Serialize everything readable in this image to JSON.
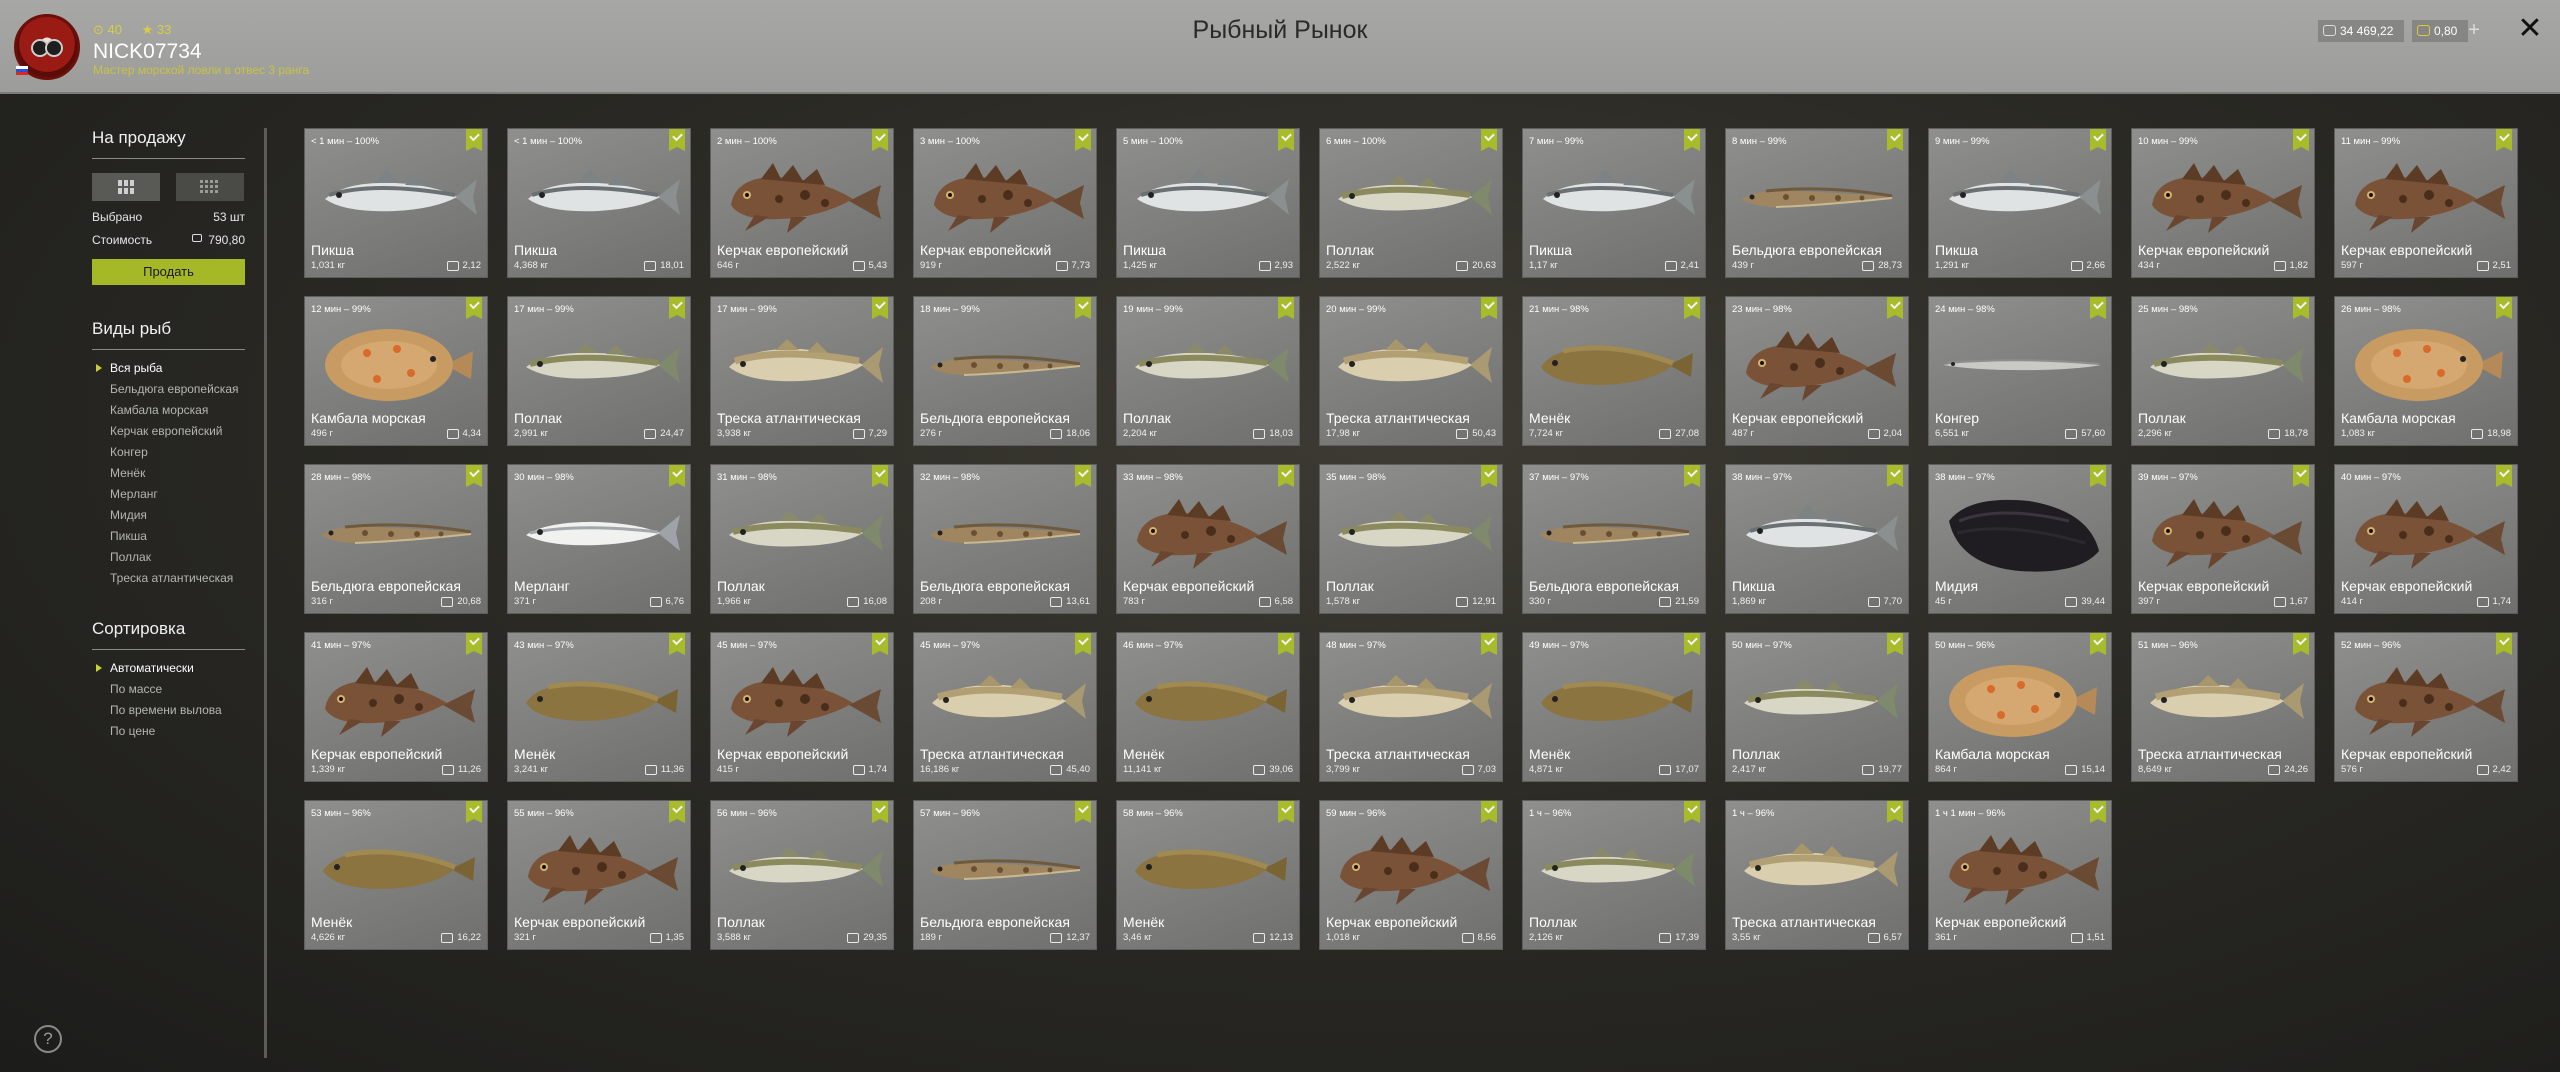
{
  "header": {
    "title": "Рыбный Рынок",
    "user": {
      "name": "NICK07734",
      "rank_text": "Мастер морской ловли в отвес 3 ранга",
      "stat1": "40",
      "stat2": "33"
    },
    "balance_silver": "34 469,22",
    "balance_gold": "0,80",
    "plus": "+",
    "close": "✕"
  },
  "sidebar": {
    "sale_title": "На продажу",
    "selected_label": "Выбрано",
    "selected_value": "53 шт",
    "cost_label": "Стоимость",
    "cost_value": "790,80",
    "sell_button": "Продать",
    "species_title": "Виды рыб",
    "species": [
      "Вся рыба",
      "Бельдюга европейская",
      "Камбала морская",
      "Керчак европейский",
      "Конгер",
      "Менёк",
      "Мерланг",
      "Мидия",
      "Пикша",
      "Поллак",
      "Треска атлантическая"
    ],
    "sort_title": "Сортировка",
    "sort_options": [
      "Автоматически",
      "По массе",
      "По времени вылова",
      "По цене"
    ],
    "help": "?"
  },
  "colors": {
    "accent": "#a8bb2a",
    "header_bg": "#a7a8a5",
    "card_bg": "#858583"
  },
  "cards": [
    {
      "meta": "< 1 мин – 100%",
      "name": "Пикша",
      "weight": "1,031 кг",
      "price": "2,12",
      "type": "haddock"
    },
    {
      "meta": "< 1 мин – 100%",
      "name": "Пикша",
      "weight": "4,368 кг",
      "price": "18,01",
      "type": "haddock"
    },
    {
      "meta": "2 мин – 100%",
      "name": "Керчак европейский",
      "weight": "646 г",
      "price": "5,43",
      "type": "sculpin"
    },
    {
      "meta": "3 мин – 100%",
      "name": "Керчак европейский",
      "weight": "919 г",
      "price": "7,73",
      "type": "sculpin"
    },
    {
      "meta": "5 мин – 100%",
      "name": "Пикша",
      "weight": "1,425 кг",
      "price": "2,93",
      "type": "haddock"
    },
    {
      "meta": "6 мин – 100%",
      "name": "Поллак",
      "weight": "2,522 кг",
      "price": "20,63",
      "type": "pollack"
    },
    {
      "meta": "7 мин – 99%",
      "name": "Пикша",
      "weight": "1,17 кг",
      "price": "2,41",
      "type": "haddock"
    },
    {
      "meta": "8 мин – 99%",
      "name": "Бельдюга европейская",
      "weight": "439 г",
      "price": "28,73",
      "type": "eelpout"
    },
    {
      "meta": "9 мин – 99%",
      "name": "Пикша",
      "weight": "1,291 кг",
      "price": "2,66",
      "type": "haddock"
    },
    {
      "meta": "10 мин – 99%",
      "name": "Керчак европейский",
      "weight": "434 г",
      "price": "1,82",
      "type": "sculpin"
    },
    {
      "meta": "11 мин – 99%",
      "name": "Керчак европейский",
      "weight": "597 г",
      "price": "2,51",
      "type": "sculpin"
    },
    {
      "meta": "12 мин – 99%",
      "name": "Камбала морская",
      "weight": "496 г",
      "price": "4,34",
      "type": "plaice"
    },
    {
      "meta": "17 мин – 99%",
      "name": "Поллак",
      "weight": "2,991 кг",
      "price": "24,47",
      "type": "pollack"
    },
    {
      "meta": "17 мин – 99%",
      "name": "Треска атлантическая",
      "weight": "3,938 кг",
      "price": "7,29",
      "type": "cod"
    },
    {
      "meta": "18 мин – 99%",
      "name": "Бельдюга европейская",
      "weight": "276 г",
      "price": "18,06",
      "type": "eelpout"
    },
    {
      "meta": "19 мин – 99%",
      "name": "Поллак",
      "weight": "2,204 кг",
      "price": "18,03",
      "type": "pollack"
    },
    {
      "meta": "20 мин – 99%",
      "name": "Треска атлантическая",
      "weight": "17,98 кг",
      "price": "50,43",
      "type": "cod"
    },
    {
      "meta": "21 мин – 98%",
      "name": "Менёк",
      "weight": "7,724 кг",
      "price": "27,08",
      "type": "tusk"
    },
    {
      "meta": "23 мин – 98%",
      "name": "Керчак европейский",
      "weight": "487 г",
      "price": "2,04",
      "type": "sculpin"
    },
    {
      "meta": "24 мин – 98%",
      "name": "Конгер",
      "weight": "6,551 кг",
      "price": "57,60",
      "type": "conger"
    },
    {
      "meta": "25 мин – 98%",
      "name": "Поллак",
      "weight": "2,296 кг",
      "price": "18,78",
      "type": "pollack"
    },
    {
      "meta": "26 мин – 98%",
      "name": "Камбала морская",
      "weight": "1,083 кг",
      "price": "18,98",
      "type": "plaice"
    },
    {
      "meta": "28 мин – 98%",
      "name": "Бельдюга европейская",
      "weight": "316 г",
      "price": "20,68",
      "type": "eelpout"
    },
    {
      "meta": "30 мин – 98%",
      "name": "Мерланг",
      "weight": "371 г",
      "price": "6,76",
      "type": "whiting"
    },
    {
      "meta": "31 мин – 98%",
      "name": "Поллак",
      "weight": "1,966 кг",
      "price": "16,08",
      "type": "pollack"
    },
    {
      "meta": "32 мин – 98%",
      "name": "Бельдюга европейская",
      "weight": "208 г",
      "price": "13,61",
      "type": "eelpout"
    },
    {
      "meta": "33 мин – 98%",
      "name": "Керчак европейский",
      "weight": "783 г",
      "price": "6,58",
      "type": "sculpin"
    },
    {
      "meta": "35 мин – 98%",
      "name": "Поллак",
      "weight": "1,578 кг",
      "price": "12,91",
      "type": "pollack"
    },
    {
      "meta": "37 мин – 97%",
      "name": "Бельдюга европейская",
      "weight": "330 г",
      "price": "21,59",
      "type": "eelpout"
    },
    {
      "meta": "38 мин – 97%",
      "name": "Пикша",
      "weight": "1,869 кг",
      "price": "7,70",
      "type": "haddock"
    },
    {
      "meta": "38 мин – 97%",
      "name": "Мидия",
      "weight": "45 г",
      "price": "39,44",
      "type": "mussel"
    },
    {
      "meta": "39 мин – 97%",
      "name": "Керчак европейский",
      "weight": "397 г",
      "price": "1,67",
      "type": "sculpin"
    },
    {
      "meta": "40 мин – 97%",
      "name": "Керчак европейский",
      "weight": "414 г",
      "price": "1,74",
      "type": "sculpin"
    },
    {
      "meta": "41 мин – 97%",
      "name": "Керчак европейский",
      "weight": "1,339 кг",
      "price": "11,26",
      "type": "sculpin"
    },
    {
      "meta": "43 мин – 97%",
      "name": "Менёк",
      "weight": "3,241 кг",
      "price": "11,36",
      "type": "tusk"
    },
    {
      "meta": "45 мин – 97%",
      "name": "Керчак европейский",
      "weight": "415 г",
      "price": "1,74",
      "type": "sculpin"
    },
    {
      "meta": "45 мин – 97%",
      "name": "Треска атлантическая",
      "weight": "16,186 кг",
      "price": "45,40",
      "type": "cod"
    },
    {
      "meta": "46 мин – 97%",
      "name": "Менёк",
      "weight": "11,141 кг",
      "price": "39,06",
      "type": "tusk"
    },
    {
      "meta": "48 мин – 97%",
      "name": "Треска атлантическая",
      "weight": "3,799 кг",
      "price": "7,03",
      "type": "cod"
    },
    {
      "meta": "49 мин – 97%",
      "name": "Менёк",
      "weight": "4,871 кг",
      "price": "17,07",
      "type": "tusk"
    },
    {
      "meta": "50 мин – 97%",
      "name": "Поллак",
      "weight": "2,417 кг",
      "price": "19,77",
      "type": "pollack"
    },
    {
      "meta": "50 мин – 96%",
      "name": "Камбала морская",
      "weight": "864 г",
      "price": "15,14",
      "type": "plaice"
    },
    {
      "meta": "51 мин – 96%",
      "name": "Треска атлантическая",
      "weight": "8,649 кг",
      "price": "24,26",
      "type": "cod"
    },
    {
      "meta": "52 мин – 96%",
      "name": "Керчак европейский",
      "weight": "576 г",
      "price": "2,42",
      "type": "sculpin"
    },
    {
      "meta": "53 мин – 96%",
      "name": "Менёк",
      "weight": "4,626 кг",
      "price": "16,22",
      "type": "tusk"
    },
    {
      "meta": "55 мин – 96%",
      "name": "Керчак европейский",
      "weight": "321 г",
      "price": "1,35",
      "type": "sculpin"
    },
    {
      "meta": "56 мин – 96%",
      "name": "Поллак",
      "weight": "3,588 кг",
      "price": "29,35",
      "type": "pollack"
    },
    {
      "meta": "57 мин – 96%",
      "name": "Бельдюга европейская",
      "weight": "189 г",
      "price": "12,37",
      "type": "eelpout"
    },
    {
      "meta": "58 мин – 96%",
      "name": "Менёк",
      "weight": "3,46 кг",
      "price": "12,13",
      "type": "tusk"
    },
    {
      "meta": "59 мин – 96%",
      "name": "Керчак европейский",
      "weight": "1,018 кг",
      "price": "8,56",
      "type": "sculpin"
    },
    {
      "meta": "1 ч – 96%",
      "name": "Поллак",
      "weight": "2,126 кг",
      "price": "17,39",
      "type": "pollack"
    },
    {
      "meta": "1 ч – 96%",
      "name": "Треска атлантическая",
      "weight": "3,55 кг",
      "price": "6,57",
      "type": "cod"
    },
    {
      "meta": "1 ч 1 мин – 96%",
      "name": "Керчак европейский",
      "weight": "361 г",
      "price": "1,51",
      "type": "sculpin"
    }
  ]
}
